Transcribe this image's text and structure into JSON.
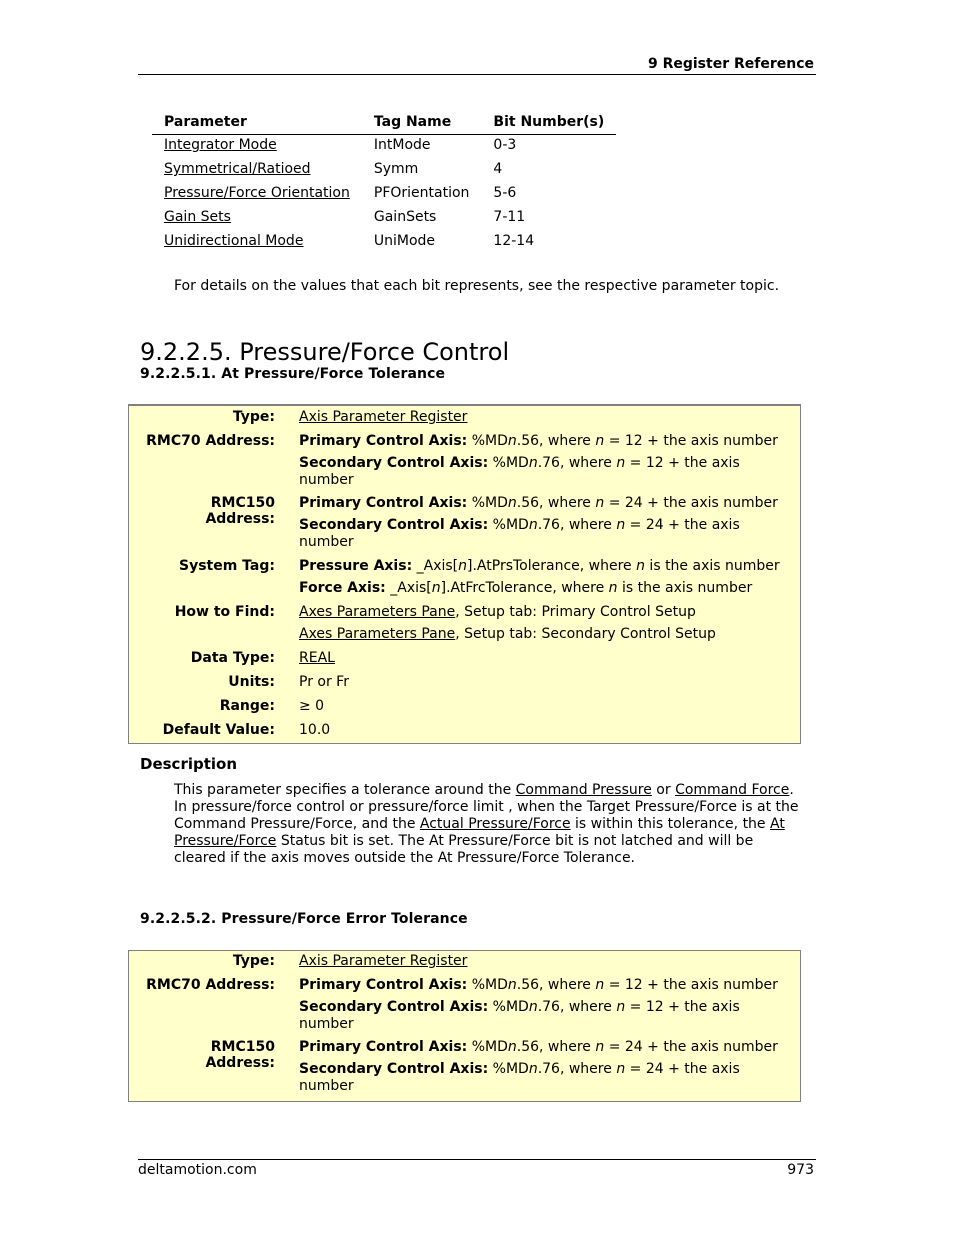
{
  "header": {
    "title": "9  Register Reference"
  },
  "bit_table": {
    "columns": [
      "Parameter",
      "Tag Name",
      "Bit Number(s)"
    ],
    "rows": [
      [
        "Integrator Mode",
        "IntMode",
        "0-3"
      ],
      [
        "Symmetrical/Ratioed",
        "Symm",
        "4"
      ],
      [
        "Pressure/Force Orientation",
        "PFOrientation",
        "5-6"
      ],
      [
        "Gain Sets",
        "GainSets",
        "7-11"
      ],
      [
        "Unidirectional Mode",
        "UniMode",
        "12-14"
      ]
    ]
  },
  "note": "For details on the values that each bit represents, see the respective parameter topic.",
  "section": {
    "title": "9.2.2.5. Pressure/Force Control"
  },
  "sub1": {
    "title": "9.2.2.5.1. At Pressure/Force Tolerance",
    "type_label": "Type:",
    "type_value": "Axis Parameter Register",
    "rmc70_label": "RMC70 Address:",
    "rmc150_label": "RMC150 Address:",
    "primary_label": "Primary Control Axis:",
    "secondary_label": "Secondary Control Axis:",
    "rmc70_primary": " %MDn.56, where n = 12 + the axis number",
    "rmc70_secondary": " %MDn.76, where n = 12 + the axis number",
    "rmc150_primary": " %MDn.56, where n = 24 + the axis number",
    "rmc150_secondary": " %MDn.76, where n = 24 + the axis number",
    "systag_label": "System Tag:",
    "pressure_axis_label": "Pressure Axis:",
    "pressure_axis_value": " _Axis[n].AtPrsTolerance, where n is the axis number",
    "force_axis_label": "Force Axis:",
    "force_axis_value": " _Axis[n].AtFrcTolerance, where n is the axis number",
    "howto_label": "How to Find:",
    "howto_link": "Axes Parameters Pane",
    "howto_1": ", Setup tab: Primary Control Setup",
    "howto_2": ", Setup tab: Secondary Control Setup",
    "datatype_label": "Data Type:",
    "datatype_value": "REAL",
    "units_label": "Units:",
    "units_value": "Pr or Fr",
    "range_label": "Range:",
    "range_value": "≥ 0",
    "default_label": "Default Value:",
    "default_value": "10.0"
  },
  "description": {
    "heading": "Description",
    "t1": "This parameter specifies a tolerance around the ",
    "l1": "Command Pressure",
    "t2": " or ",
    "l2": "Command Force",
    "t3": ". In pressure/force control or pressure/force limit , when the Target Pressure/Force is at the Command Pressure/Force, and the ",
    "l3": "Actual Pressure/Force",
    "t4": " is within this tolerance, the ",
    "l4": "At Pressure/Force",
    "t5": " Status bit is set. The At Pressure/Force bit is not latched and will be cleared if the axis moves outside the At Pressure/Force Tolerance."
  },
  "sub2": {
    "title": "9.2.2.5.2. Pressure/Force Error Tolerance",
    "type_label": "Type:",
    "type_value": "Axis Parameter Register",
    "rmc70_label": "RMC70 Address:",
    "rmc150_label": "RMC150 Address:",
    "primary_label": "Primary Control Axis:",
    "secondary_label": "Secondary Control Axis:",
    "rmc70_primary": " %MDn.56, where n = 12 + the axis number",
    "rmc70_secondary": " %MDn.76, where n = 12 + the axis number",
    "rmc150_primary": " %MDn.56, where n = 24 + the axis number",
    "rmc150_secondary": " %MDn.76, where n = 24 + the axis number"
  },
  "footer": {
    "site": "deltamotion.com",
    "page": "973"
  }
}
